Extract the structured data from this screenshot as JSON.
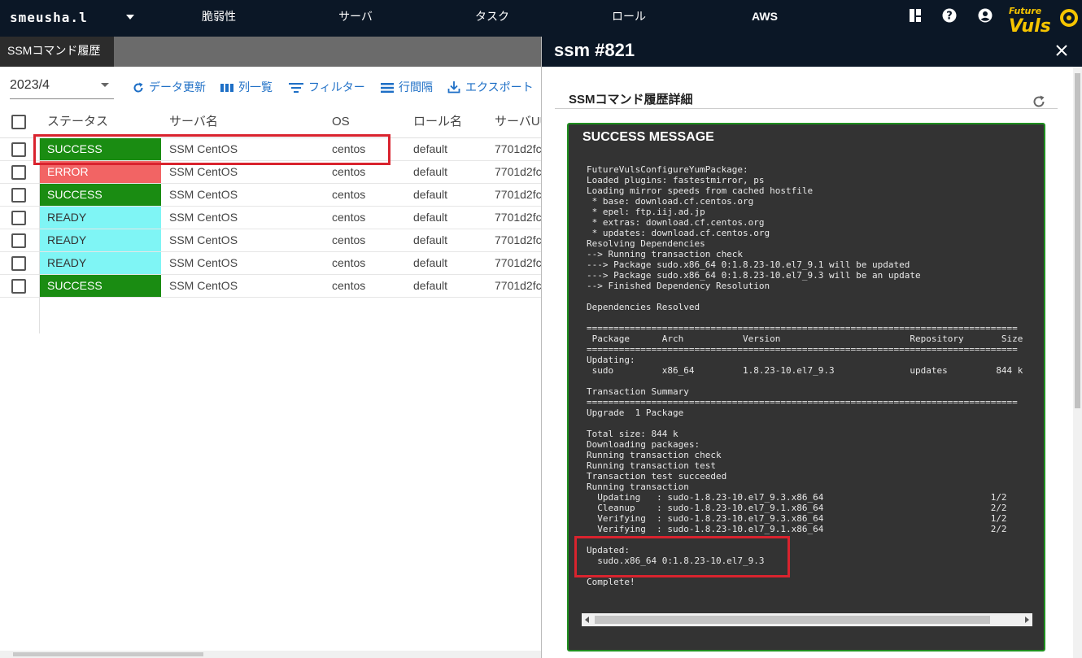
{
  "header": {
    "brand": "smeusha.l",
    "nav": [
      "脆弱性",
      "サーバ",
      "タスク",
      "ロール",
      "AWS"
    ],
    "logo_text": [
      "Future",
      "Vuls"
    ]
  },
  "left": {
    "tab": "SSMコマンド履歴",
    "month": "2023/4",
    "toolbar": {
      "refresh": "データ更新",
      "columns": "列一覧",
      "filter": "フィルター",
      "density": "行間隔",
      "export": "エクスポート"
    },
    "columns": [
      "ステータス",
      "サーバ名",
      "OS",
      "ロール名",
      "サーバUU"
    ],
    "rows": [
      {
        "status": "SUCCESS",
        "server": "SSM CentOS",
        "os": "centos",
        "role": "default",
        "uuid": "7701d2fc"
      },
      {
        "status": "ERROR",
        "server": "SSM CentOS",
        "os": "centos",
        "role": "default",
        "uuid": "7701d2fc"
      },
      {
        "status": "SUCCESS",
        "server": "SSM CentOS",
        "os": "centos",
        "role": "default",
        "uuid": "7701d2fc"
      },
      {
        "status": "READY",
        "server": "SSM CentOS",
        "os": "centos",
        "role": "default",
        "uuid": "7701d2fc"
      },
      {
        "status": "READY",
        "server": "SSM CentOS",
        "os": "centos",
        "role": "default",
        "uuid": "7701d2fc"
      },
      {
        "status": "READY",
        "server": "SSM CentOS",
        "os": "centos",
        "role": "default",
        "uuid": "7701d2fc"
      },
      {
        "status": "SUCCESS",
        "server": "SSM CentOS",
        "os": "centos",
        "role": "default",
        "uuid": "7701d2fc"
      }
    ]
  },
  "colors": {
    "SUCCESS": "#1a8c12",
    "ERROR": "#f26464",
    "READY": "#7ff5f5",
    "topbar": "#0b1726",
    "accent": "#1e6fc6",
    "highlight": "#d9232e"
  },
  "detail": {
    "title": "ssm #821",
    "section": "SSMコマンド履歴詳細",
    "message_title": "SUCCESS MESSAGE",
    "console": [
      "FutureVulsConfigureYumPackage:",
      "Loaded plugins: fastestmirror, ps",
      "Loading mirror speeds from cached hostfile",
      " * base: download.cf.centos.org",
      " * epel: ftp.iij.ad.jp",
      " * extras: download.cf.centos.org",
      " * updates: download.cf.centos.org",
      "Resolving Dependencies",
      "--> Running transaction check",
      "---> Package sudo.x86_64 0:1.8.23-10.el7_9.1 will be updated",
      "---> Package sudo.x86_64 0:1.8.23-10.el7_9.3 will be an update",
      "--> Finished Dependency Resolution",
      "",
      "Dependencies Resolved",
      "",
      "================================================================================",
      " Package      Arch           Version                        Repository       Size",
      "================================================================================",
      "Updating:",
      " sudo         x86_64         1.8.23-10.el7_9.3              updates         844 k",
      "",
      "Transaction Summary",
      "================================================================================",
      "Upgrade  1 Package",
      "",
      "Total size: 844 k",
      "Downloading packages:",
      "Running transaction check",
      "Running transaction test",
      "Transaction test succeeded",
      "Running transaction",
      "  Updating   : sudo-1.8.23-10.el7_9.3.x86_64                               1/2",
      "  Cleanup    : sudo-1.8.23-10.el7_9.1.x86_64                               2/2",
      "  Verifying  : sudo-1.8.23-10.el7_9.3.x86_64                               1/2",
      "  Verifying  : sudo-1.8.23-10.el7_9.1.x86_64                               2/2",
      "",
      "Updated:",
      "  sudo.x86_64 0:1.8.23-10.el7_9.3",
      "",
      "Complete!"
    ]
  }
}
